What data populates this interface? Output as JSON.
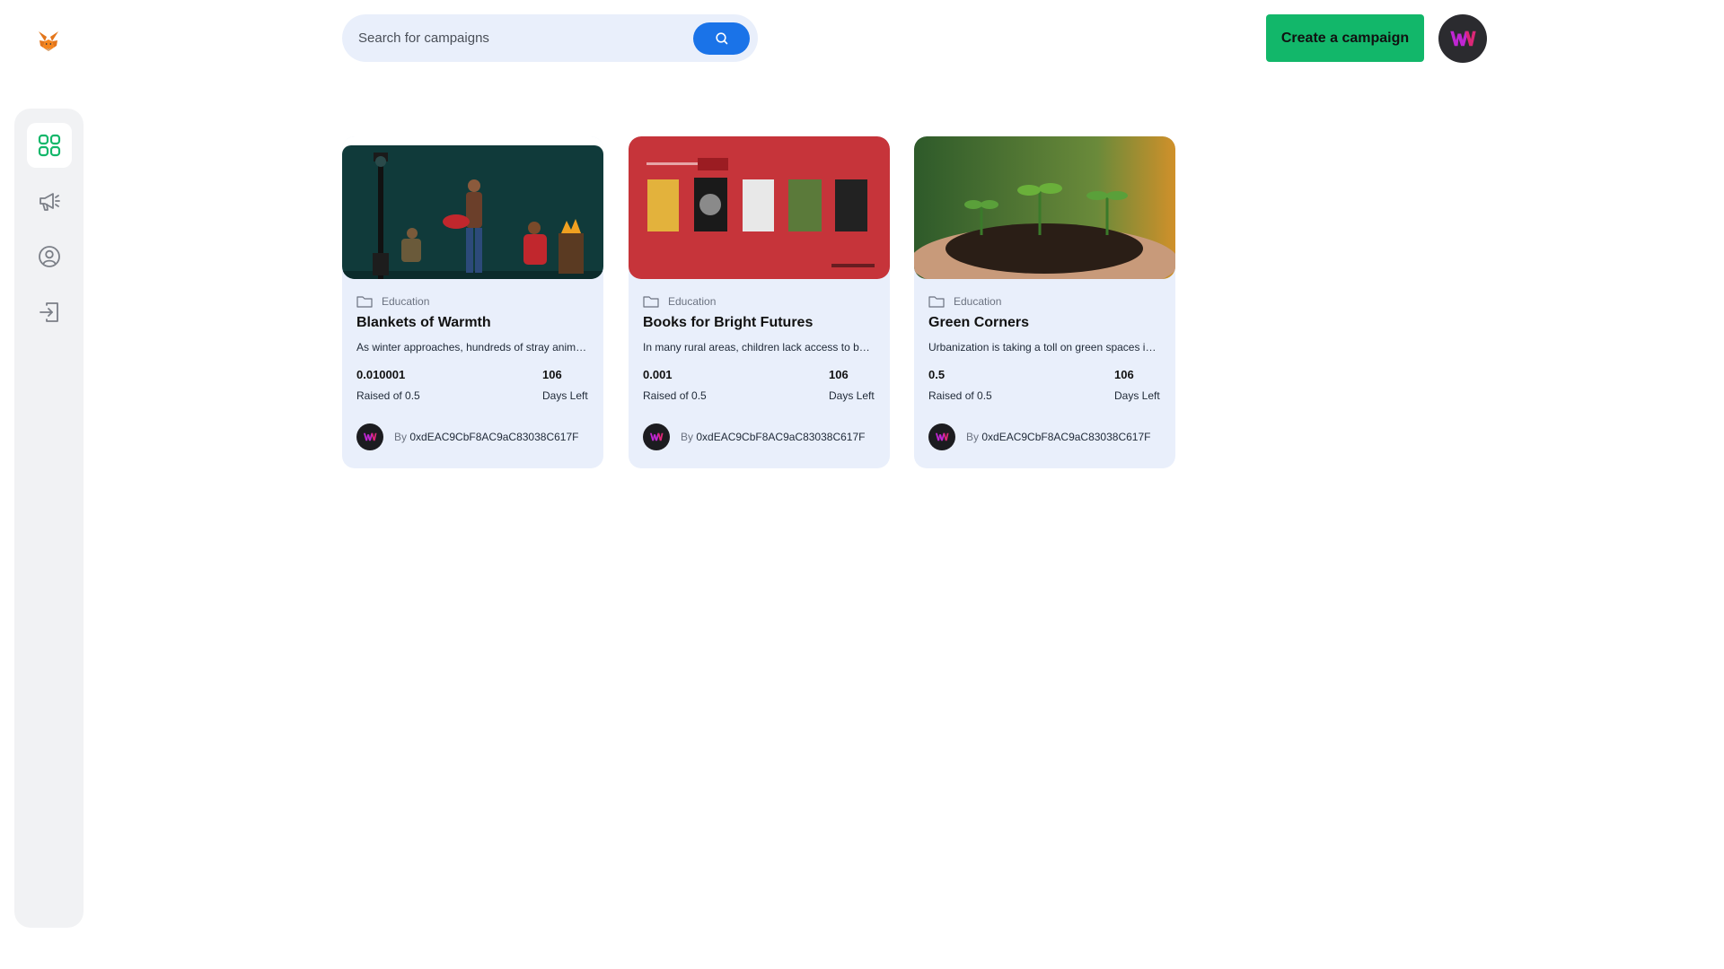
{
  "header": {
    "logo_icon": "fox-logo-icon",
    "search": {
      "placeholder": "Search for campaigns",
      "icon": "search-icon"
    },
    "create_button_label": "Create a campaign",
    "create_button_color": "#12b76a",
    "avatar_icon": "brand-w-icon"
  },
  "sidebar": {
    "items": [
      {
        "icon": "dashboard-grid-icon",
        "active": true
      },
      {
        "icon": "megaphone-icon",
        "active": false
      },
      {
        "icon": "profile-icon",
        "active": false
      },
      {
        "icon": "logout-icon",
        "active": false
      }
    ],
    "active_color": "#12b76a"
  },
  "campaigns": [
    {
      "category": "Education",
      "title": "Blankets of Warmth",
      "description": "As winter approaches, hundreds of stray animals face the cold without shelter",
      "raised_value": "0.010001",
      "raised_label": "Raised of 0.5",
      "days_value": "106",
      "days_label": "Days Left",
      "owner_prefix": "By",
      "owner": "0xdEAC9CbF8AC9aC83038C617F"
    },
    {
      "category": "Education",
      "title": "Books for Bright Futures",
      "description": "In many rural areas, children lack access to books and learning materials",
      "raised_value": "0.001",
      "raised_label": "Raised of 0.5",
      "days_value": "106",
      "days_label": "Days Left",
      "owner_prefix": "By",
      "owner": "0xdEAC9CbF8AC9aC83038C617F"
    },
    {
      "category": "Education",
      "title": "Green Corners",
      "description": "Urbanization is taking a toll on green spaces in our neighborhoods",
      "raised_value": "0.5",
      "raised_label": "Raised of 0.5",
      "days_value": "106",
      "days_label": "Days Left",
      "owner_prefix": "By",
      "owner": "0xdEAC9CbF8AC9aC83038C617F"
    }
  ]
}
